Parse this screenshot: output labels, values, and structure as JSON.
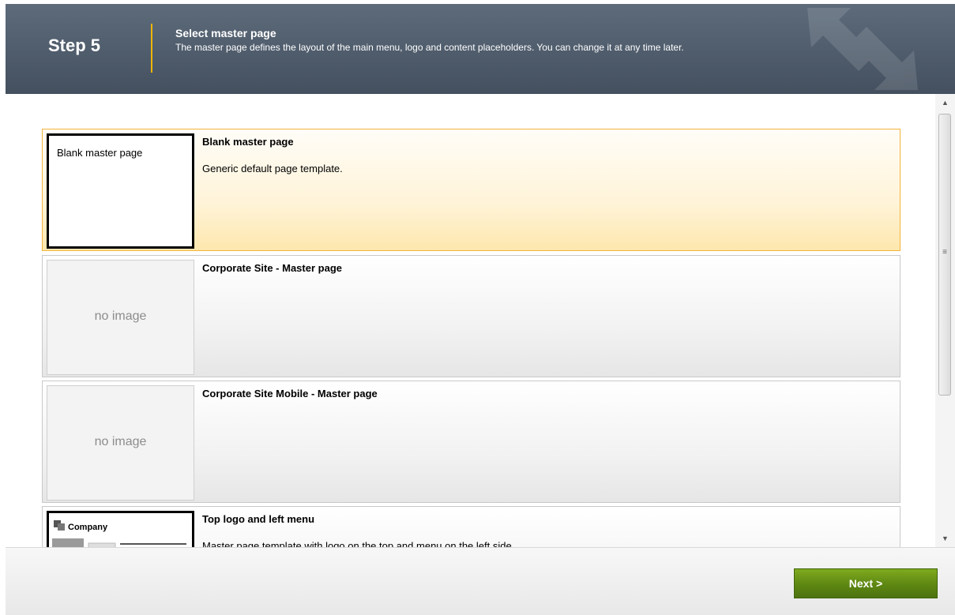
{
  "header": {
    "step": "Step 5",
    "title": "Select master page",
    "description": "The master page defines the layout of the main menu, logo and content placeholders. You can change it at any time later."
  },
  "master_pages": [
    {
      "title": "Blank master page",
      "description": "Generic default page template.",
      "thumbnail_text": "Blank master page",
      "selected": true
    },
    {
      "title": "Corporate Site - Master page",
      "description": "",
      "thumbnail_text": "no image",
      "selected": false
    },
    {
      "title": "Corporate Site Mobile - Master page",
      "description": "",
      "thumbnail_text": "no image",
      "selected": false
    },
    {
      "title": "Top logo and left menu",
      "description": "Master page template with logo on the top and menu on the left side.",
      "thumbnail_text": "Company",
      "selected": false
    }
  ],
  "footer": {
    "next_label": "Next >"
  },
  "colors": {
    "header_bg": "#4f5b6a",
    "header_accent": "#f0b400",
    "selected_bg": "#fde7ae",
    "next_button": "#5d8712"
  },
  "icons": {
    "header_logo": "arrows-logo-icon",
    "scroll_up": "arrow-up-icon",
    "scroll_down": "arrow-down-icon"
  }
}
